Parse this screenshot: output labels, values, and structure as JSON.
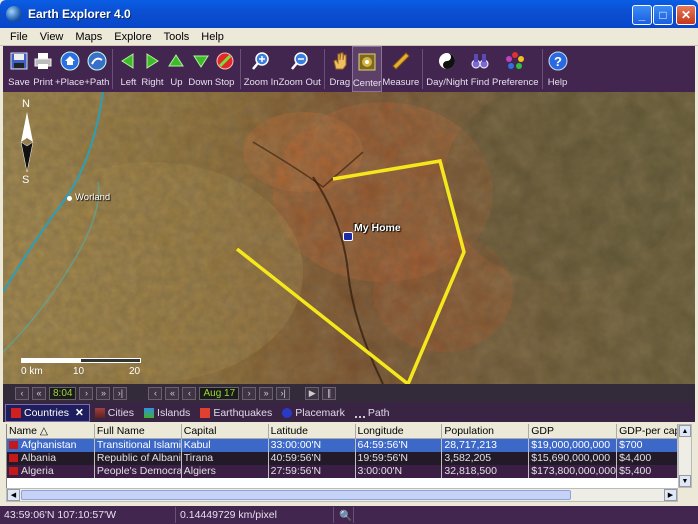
{
  "window": {
    "title": "Earth Explorer 4.0"
  },
  "menu": [
    "File",
    "View",
    "Maps",
    "Explore",
    "Tools",
    "Help"
  ],
  "toolbar": [
    {
      "label": "Save",
      "icon": "save-icon"
    },
    {
      "label": "Print",
      "icon": "print-icon"
    },
    {
      "label": "+Place",
      "icon": "home-icon"
    },
    {
      "label": "+Path",
      "icon": "path-icon"
    },
    {
      "label": "Left",
      "icon": "arrow-left-icon"
    },
    {
      "label": "Right",
      "icon": "arrow-right-icon"
    },
    {
      "label": "Up",
      "icon": "arrow-up-icon"
    },
    {
      "label": "Down",
      "icon": "arrow-down-icon"
    },
    {
      "label": "Stop",
      "icon": "stop-icon"
    },
    {
      "label": "Zoom In",
      "icon": "zoom-in-icon"
    },
    {
      "label": "Zoom Out",
      "icon": "zoom-out-icon"
    },
    {
      "label": "Drag",
      "icon": "hand-icon"
    },
    {
      "label": "Center",
      "icon": "center-icon"
    },
    {
      "label": "Measure",
      "icon": "ruler-icon"
    },
    {
      "label": "Day/Night",
      "icon": "yin-yang-icon"
    },
    {
      "label": "Find",
      "icon": "binoculars-icon"
    },
    {
      "label": "Preference",
      "icon": "palette-icon"
    },
    {
      "label": "Help",
      "icon": "help-icon"
    }
  ],
  "map": {
    "compass_n": "N",
    "compass_s": "S",
    "city_label": "Worland",
    "placemark_label": "My Home",
    "scale_labels": [
      "0 km",
      "10",
      "20"
    ],
    "path_color": "#f4e81c"
  },
  "timeline": {
    "time": "8:04",
    "date": "Aug 17"
  },
  "tabs": [
    "Countries",
    "Cities",
    "Islands",
    "Earthquakes",
    "Placemark",
    "Path"
  ],
  "table": {
    "columns": [
      "Name",
      "Full Name",
      "Capital",
      "Latitude",
      "Longitude",
      "Population",
      "GDP",
      "GDP-per capi"
    ],
    "rows": [
      [
        "Afghanistan",
        "Transitional Islami...",
        "Kabul",
        "33:00:00'N",
        "64:59:56'N",
        "28,717,213",
        "$19,000,000,000",
        "$700"
      ],
      [
        "Albania",
        "Republic of Albania",
        "Tirana",
        "40:59:56'N",
        "19:59:56'N",
        "3,582,205",
        "$15,690,000,000",
        "$4,400"
      ],
      [
        "Algeria",
        "People's Democrat...",
        "Algiers",
        "27:59:56'N",
        "3:00:00'N",
        "32,818,500",
        "$173,800,000,000",
        "$5,400"
      ]
    ]
  },
  "status": {
    "coords": "43:59:06'N   107:10:57'W",
    "scale": "0.14449729 km/pixel"
  }
}
